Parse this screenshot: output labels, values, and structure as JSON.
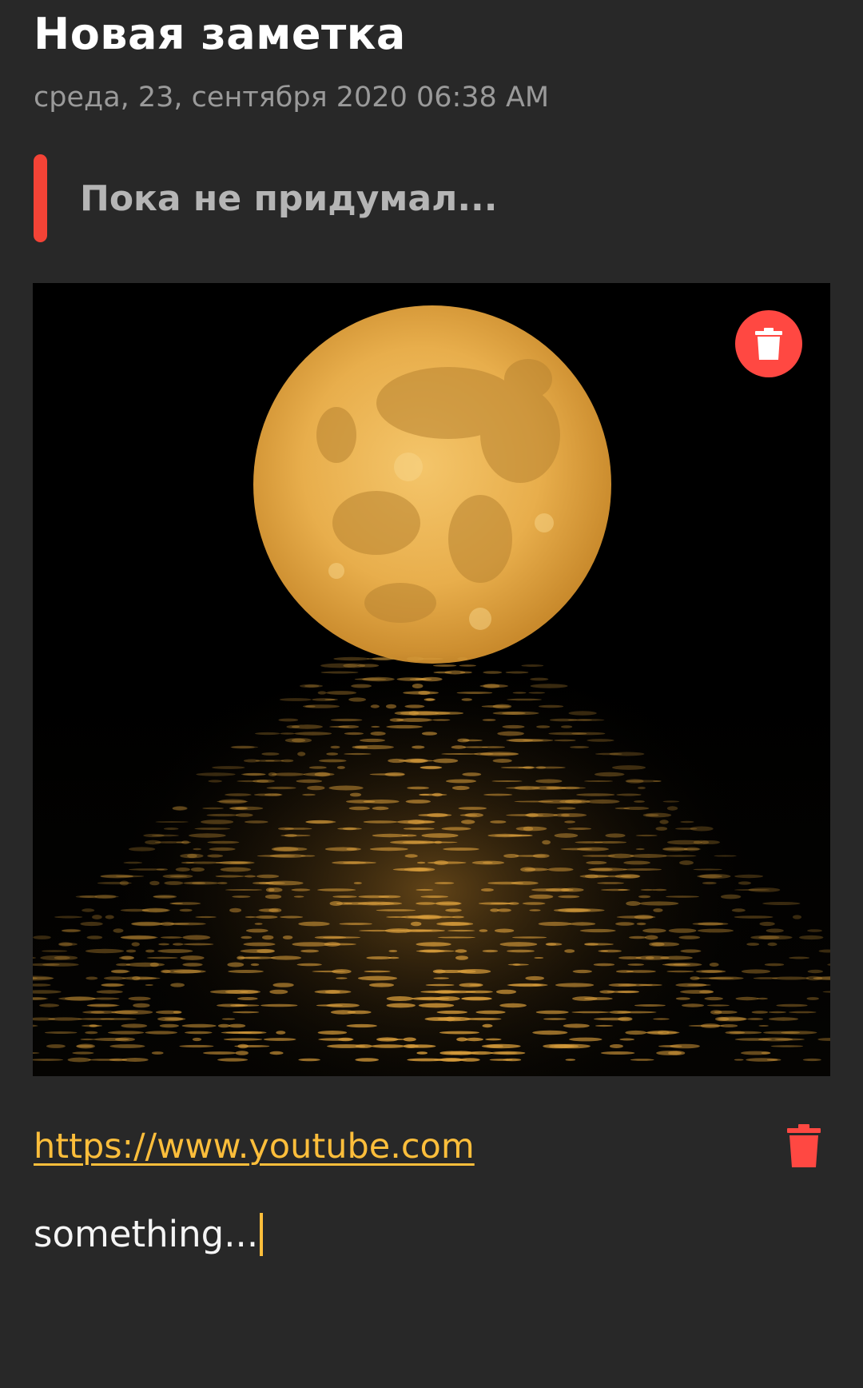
{
  "note": {
    "title": "Новая заметка",
    "datetime": "среда, 23, сентября 2020 06:38 AM",
    "subtitle": "Пока не придумал...",
    "indicator_color": "#F44336",
    "image_description_icon": "moon-over-sea-image",
    "url": "https://www.youtube.com",
    "body": "something..."
  },
  "icons": {
    "delete_image": "trash-icon",
    "delete_url": "trash-icon"
  },
  "colors": {
    "background": "#282828",
    "accent": "#FDBE3B",
    "delete": "#FF4842",
    "text": "#FFFFFF",
    "muted": "#9A9A9A"
  }
}
